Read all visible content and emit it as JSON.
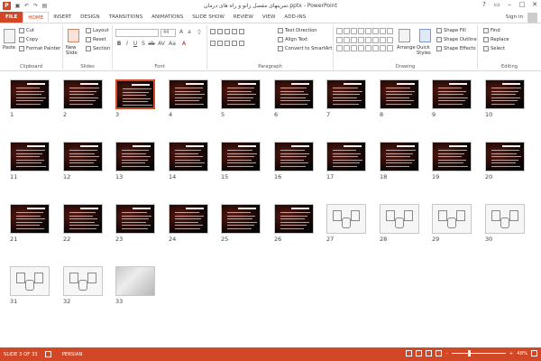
{
  "titlebar": {
    "app_icon": "P",
    "title": "تمرینهای مفصل زانو و راه های درمان.pptx - PowerPoint",
    "help": "?",
    "quick_access": [
      "save-icon",
      "undo-icon",
      "redo-icon",
      "start-icon"
    ]
  },
  "tabs": {
    "file": "FILE",
    "items": [
      "HOME",
      "INSERT",
      "DESIGN",
      "TRANSITIONS",
      "ANIMATIONS",
      "SLIDE SHOW",
      "REVIEW",
      "VIEW",
      "ADD-INS"
    ],
    "active": "HOME",
    "signin": "Sign in"
  },
  "ribbon": {
    "clipboard": {
      "paste": "Paste",
      "cut": "Cut",
      "copy": "Copy",
      "format_painter": "Format Painter",
      "label": "Clipboard"
    },
    "slides": {
      "new_slide": "New Slide",
      "layout": "Layout",
      "reset": "Reset",
      "section": "Section",
      "label": "Slides"
    },
    "font": {
      "font_name": "",
      "font_size": "44",
      "label": "Font",
      "buttons": [
        "B",
        "I",
        "U",
        "S",
        "ab",
        "AV",
        "Aa",
        "A"
      ]
    },
    "paragraph": {
      "text_direction": "Text Direction",
      "align_text": "Align Text",
      "convert_smartart": "Convert to SmartArt",
      "label": "Paragraph"
    },
    "drawing": {
      "arrange": "Arrange",
      "quick_styles": "Quick Styles",
      "shape_fill": "Shape Fill",
      "shape_outline": "Shape Outline",
      "shape_effects": "Shape Effects",
      "label": "Drawing"
    },
    "editing": {
      "find": "Find",
      "replace": "Replace",
      "select": "Select",
      "label": "Editing"
    }
  },
  "slides": [
    {
      "num": "1",
      "kind": "dark"
    },
    {
      "num": "2",
      "kind": "dark"
    },
    {
      "num": "3",
      "kind": "dark",
      "selected": true
    },
    {
      "num": "4",
      "kind": "dark"
    },
    {
      "num": "5",
      "kind": "dark"
    },
    {
      "num": "6",
      "kind": "dark"
    },
    {
      "num": "7",
      "kind": "dark"
    },
    {
      "num": "8",
      "kind": "dark"
    },
    {
      "num": "9",
      "kind": "dark"
    },
    {
      "num": "10",
      "kind": "dark"
    },
    {
      "num": "11",
      "kind": "dark"
    },
    {
      "num": "12",
      "kind": "dark"
    },
    {
      "num": "13",
      "kind": "dark"
    },
    {
      "num": "14",
      "kind": "dark"
    },
    {
      "num": "15",
      "kind": "dark"
    },
    {
      "num": "16",
      "kind": "dark"
    },
    {
      "num": "17",
      "kind": "dark"
    },
    {
      "num": "18",
      "kind": "dark"
    },
    {
      "num": "19",
      "kind": "dark"
    },
    {
      "num": "20",
      "kind": "dark"
    },
    {
      "num": "21",
      "kind": "dark"
    },
    {
      "num": "22",
      "kind": "dark"
    },
    {
      "num": "23",
      "kind": "dark"
    },
    {
      "num": "24",
      "kind": "dark"
    },
    {
      "num": "25",
      "kind": "dark"
    },
    {
      "num": "26",
      "kind": "dark"
    },
    {
      "num": "27",
      "kind": "sketch"
    },
    {
      "num": "28",
      "kind": "sketch"
    },
    {
      "num": "29",
      "kind": "sketch"
    },
    {
      "num": "30",
      "kind": "sketch"
    },
    {
      "num": "31",
      "kind": "sketch"
    },
    {
      "num": "32",
      "kind": "sketch"
    },
    {
      "num": "33",
      "kind": "photo"
    }
  ],
  "status": {
    "slide_info": "SLIDE 3 OF 33",
    "language": "PERSIAN",
    "zoom": "48%"
  },
  "colors": {
    "accent": "#d24726"
  }
}
